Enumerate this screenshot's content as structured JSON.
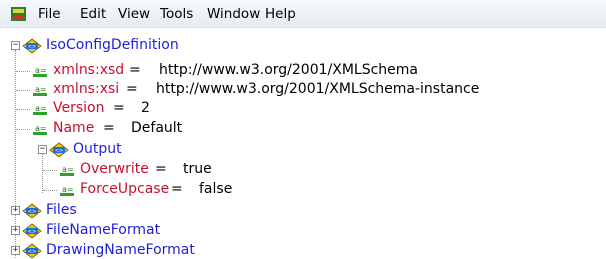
{
  "menu": [
    "File",
    "Edit",
    "View",
    "Tools",
    "Window",
    "Help"
  ],
  "tree": {
    "root": "IsoConfigDefinition",
    "attributes": [
      {
        "name": "xmlns:xsd",
        "value": "http://www.w3.org/2001/XMLSchema"
      },
      {
        "name": "xmlns:xsi",
        "value": "http://www.w3.org/2001/XMLSchema-instance"
      },
      {
        "name": "Version",
        "value": "2"
      },
      {
        "name": "Name",
        "value": "Default"
      }
    ],
    "output": {
      "label": "Output",
      "attributes": [
        {
          "name": "Overwrite",
          "value": "true"
        },
        {
          "name": "ForceUpcase",
          "value": "false"
        }
      ]
    },
    "collapsed": [
      "Files",
      "FileNameFormat",
      "DrawingNameFormat"
    ],
    "equals": " = "
  },
  "colors": {
    "element": "#1f1fd6",
    "attribute": "#c8102e",
    "value": "#000000"
  },
  "icons": {
    "element": "element-node-icon",
    "attribute": "attribute-node-icon",
    "app": "app-icon"
  }
}
